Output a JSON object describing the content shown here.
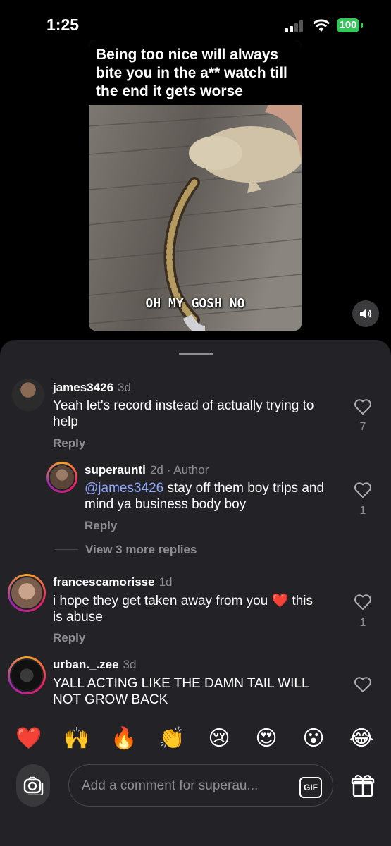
{
  "status_bar": {
    "time": "1:25",
    "battery": "100"
  },
  "video": {
    "caption": "Being too nice will always bite you in the a** watch till the end it gets worse",
    "overlay_text": "OH MY GOSH NO"
  },
  "comments": [
    {
      "username": "james3426",
      "age": "3d",
      "text": "Yeah let's record instead of actually trying to help",
      "reply_label": "Reply",
      "likes": "7"
    },
    {
      "username": "superaunti",
      "age": "2d",
      "author_label": "· Author",
      "mention": "@james3426",
      "text": " stay off them boy trips and mind ya business body boy",
      "reply_label": "Reply",
      "likes": "1"
    },
    {
      "username": "francescamorisse",
      "age": "1d",
      "text": "i hope they get taken away from you ❤️ this is abuse",
      "reply_label": "Reply",
      "likes": "1"
    },
    {
      "username": "urban._.zee",
      "age": "3d",
      "text": "YALL ACTING LIKE THE DAMN TAIL WILL NOT GROW BACK"
    }
  ],
  "view_more_replies": "View 3 more replies",
  "quick_emojis": [
    "❤️",
    "🙌",
    "🔥",
    "👏",
    "😢",
    "😍",
    "😮",
    "😂"
  ],
  "composer": {
    "placeholder": "Add a comment for superau...",
    "gif_label": "GIF"
  },
  "icons": {
    "camera": "camera-icon",
    "gift": "gift-icon",
    "heart": "heart-outline-icon",
    "sound": "speaker-icon"
  },
  "colors": {
    "sheet_bg": "#232327",
    "mention": "#8fa7ff",
    "battery": "#34c759"
  }
}
